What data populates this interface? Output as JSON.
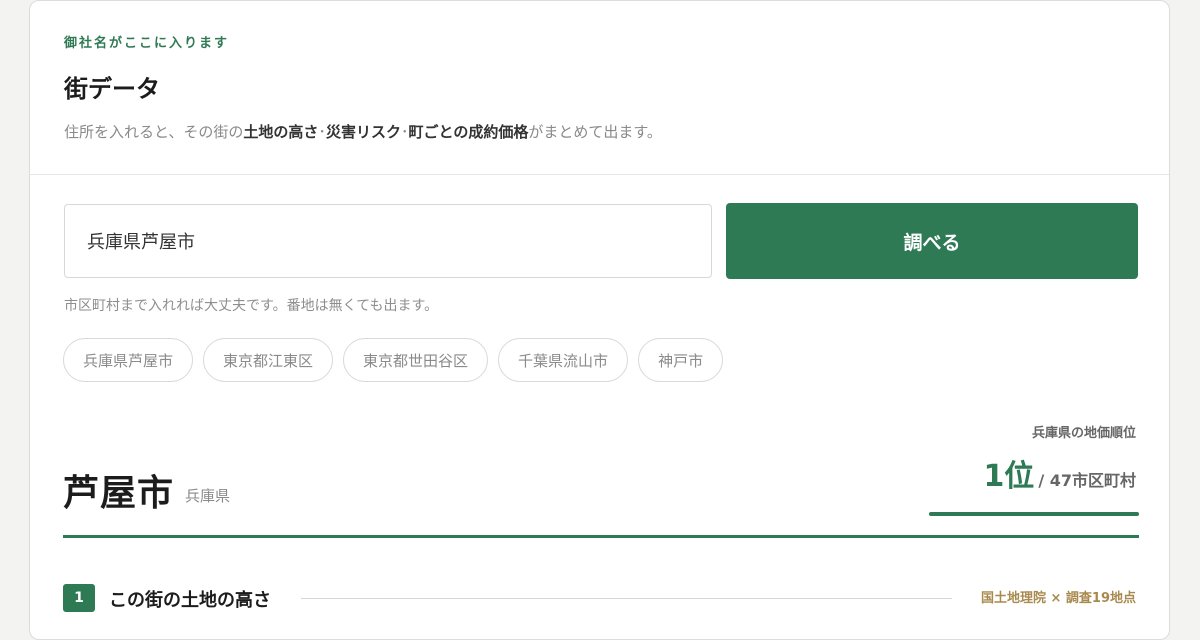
{
  "header": {
    "company": "御社名がここに入ります",
    "title": "街データ",
    "description": {
      "part1": "住所を入れると、その街の",
      "bold1": "土地の高さ",
      "sep1": "･",
      "bold2": "災害リスク",
      "sep2": "･",
      "bold3": "町ごとの成約価格",
      "part2": "がまとめて出ます。"
    }
  },
  "search": {
    "value": "兵庫県芦屋市",
    "button_label": "調べる",
    "hint": "市区町村まで入れれば大丈夫です。番地は無くても出ます。",
    "suggestions": [
      "兵庫県芦屋市",
      "東京都江東区",
      "東京都世田谷区",
      "千葉県流山市",
      "神戸市"
    ]
  },
  "result": {
    "city": "芦屋市",
    "prefecture": "兵庫県",
    "rank_label": "兵庫県の地価順位",
    "rank": "1位",
    "rank_total": "/ 47市区町村"
  },
  "section1": {
    "number": "1",
    "title": "この街の土地の高さ",
    "source": "国土地理院 × 調査19地点"
  },
  "colors": {
    "accent": "#2e7a55",
    "source_gold": "#a98a4e"
  }
}
